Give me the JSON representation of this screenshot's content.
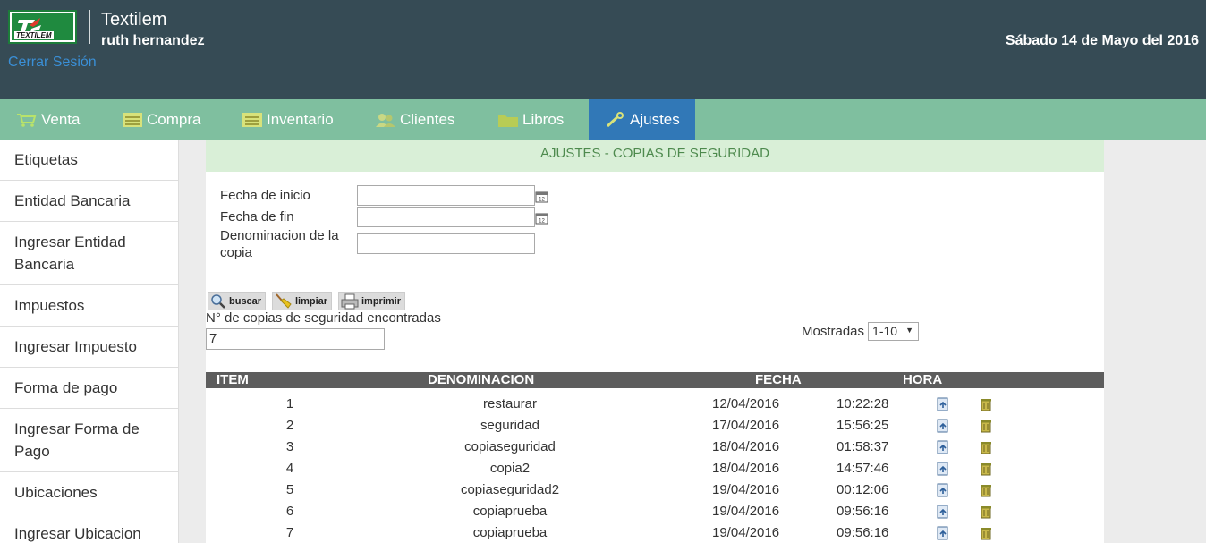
{
  "header": {
    "logo_text": "TEXTILEM",
    "app_title": "Textilem",
    "user_name": "ruth hernandez",
    "logout": "Cerrar Sesión",
    "date": "Sábado 14 de Mayo del 2016"
  },
  "nav": {
    "items": [
      {
        "label": "Venta",
        "icon": "cart-icon"
      },
      {
        "label": "Compra",
        "icon": "list-icon"
      },
      {
        "label": "Inventario",
        "icon": "list-icon"
      },
      {
        "label": "Clientes",
        "icon": "users-icon"
      },
      {
        "label": "Libros",
        "icon": "folder-icon"
      },
      {
        "label": "Ajustes",
        "icon": "wrench-icon",
        "active": true
      }
    ]
  },
  "sidebar": {
    "items": [
      {
        "label": "Etiquetas"
      },
      {
        "label": "Entidad Bancaria"
      },
      {
        "label": "Ingresar Entidad Bancaria"
      },
      {
        "label": "Impuestos"
      },
      {
        "label": "Ingresar Impuesto"
      },
      {
        "label": "Forma de pago"
      },
      {
        "label": "Ingresar Forma de Pago"
      },
      {
        "label": "Ubicaciones"
      },
      {
        "label": "Ingresar Ubicacion"
      }
    ]
  },
  "main": {
    "title": "AJUSTES - COPIAS DE SEGURIDAD",
    "form": {
      "start_label": "Fecha de inicio",
      "start_value": "",
      "end_label": "Fecha de fin",
      "end_value": "",
      "name_label": "Denominacion de la copia",
      "name_value": ""
    },
    "toolbar": {
      "search_label": "buscar",
      "clear_label": "limpiar",
      "print_label": "imprimir"
    },
    "count_label": "N° de copias de seguridad encontradas",
    "count_value": "7",
    "shown_label": "Mostradas",
    "shown_value": "1-10",
    "table": {
      "headers": [
        "ITEM",
        "DENOMINACION",
        "FECHA",
        "HORA"
      ],
      "rows": [
        {
          "item": "1",
          "name": "restaurar",
          "date": "12/04/2016",
          "time": "10:22:28"
        },
        {
          "item": "2",
          "name": "seguridad",
          "date": "17/04/2016",
          "time": "15:56:25"
        },
        {
          "item": "3",
          "name": "copiaseguridad",
          "date": "18/04/2016",
          "time": "01:58:37"
        },
        {
          "item": "4",
          "name": "copia2",
          "date": "18/04/2016",
          "time": "14:57:46"
        },
        {
          "item": "5",
          "name": "copiaseguridad2",
          "date": "19/04/2016",
          "time": "00:12:06"
        },
        {
          "item": "6",
          "name": "copiaprueba",
          "date": "19/04/2016",
          "time": "09:56:16"
        },
        {
          "item": "7",
          "name": "copiaprueba",
          "date": "19/04/2016",
          "time": "09:56:16"
        }
      ]
    }
  },
  "colors": {
    "header_bg": "#364b55",
    "nav_bg": "#7fbf9f",
    "nav_active": "#3178b7",
    "title_bg": "#d9efd7",
    "table_head_bg": "#5d5d5d"
  }
}
